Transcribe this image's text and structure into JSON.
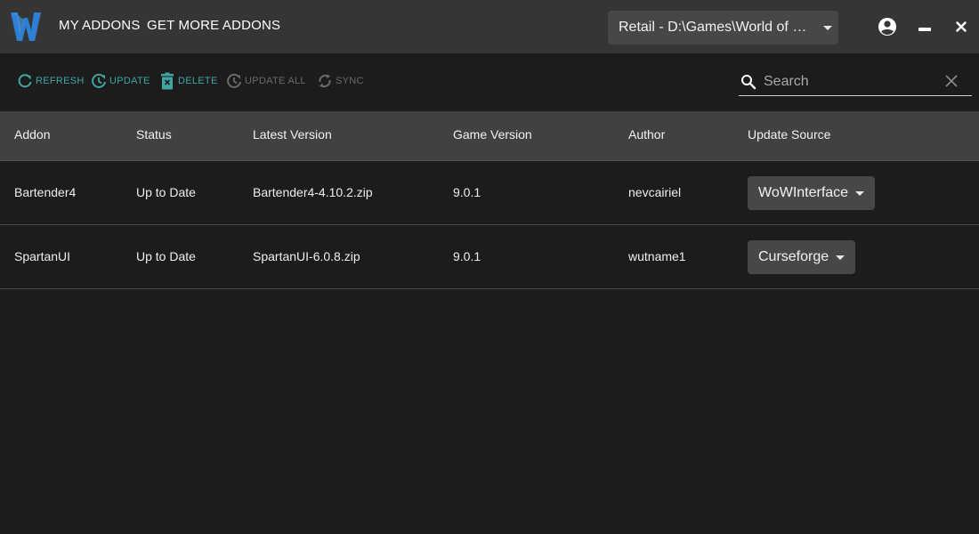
{
  "app": {
    "nav_tabs": [
      "MY ADDONS",
      "GET MORE ADDONS"
    ],
    "installation": "Retail - D:\\Games\\World of Warcraft\\_retail_",
    "window_controls": [
      "account-icon",
      "minimize-icon",
      "close-icon"
    ]
  },
  "toolbar": {
    "refresh": "REFRESH",
    "update": "UPDATE",
    "delete": "DELETE",
    "update_all": "UPDATE ALL",
    "sync": "SYNC"
  },
  "search": {
    "placeholder": "Search",
    "value": ""
  },
  "table": {
    "columns": [
      "Addon",
      "Status",
      "Latest Version",
      "Game Version",
      "Author",
      "Update Source"
    ],
    "rows": [
      {
        "addon": "Bartender4",
        "status": "Up to Date",
        "latest_version": "Bartender4-4.10.2.zip",
        "game_version": "9.0.1",
        "author": "nevcairiel",
        "update_source": "WoWInterface"
      },
      {
        "addon": "SpartanUI",
        "status": "Up to Date",
        "latest_version": "SpartanUI-6.0.8.zip",
        "game_version": "9.0.1",
        "author": "wutname1",
        "update_source": "Curseforge"
      }
    ]
  },
  "colors": {
    "accent": "#3fa7a3",
    "disabled": "#6a6a6a",
    "titlebar": "#353535",
    "background": "#1c1c1c",
    "header": "#414141",
    "logo": "#2f7fd4"
  }
}
